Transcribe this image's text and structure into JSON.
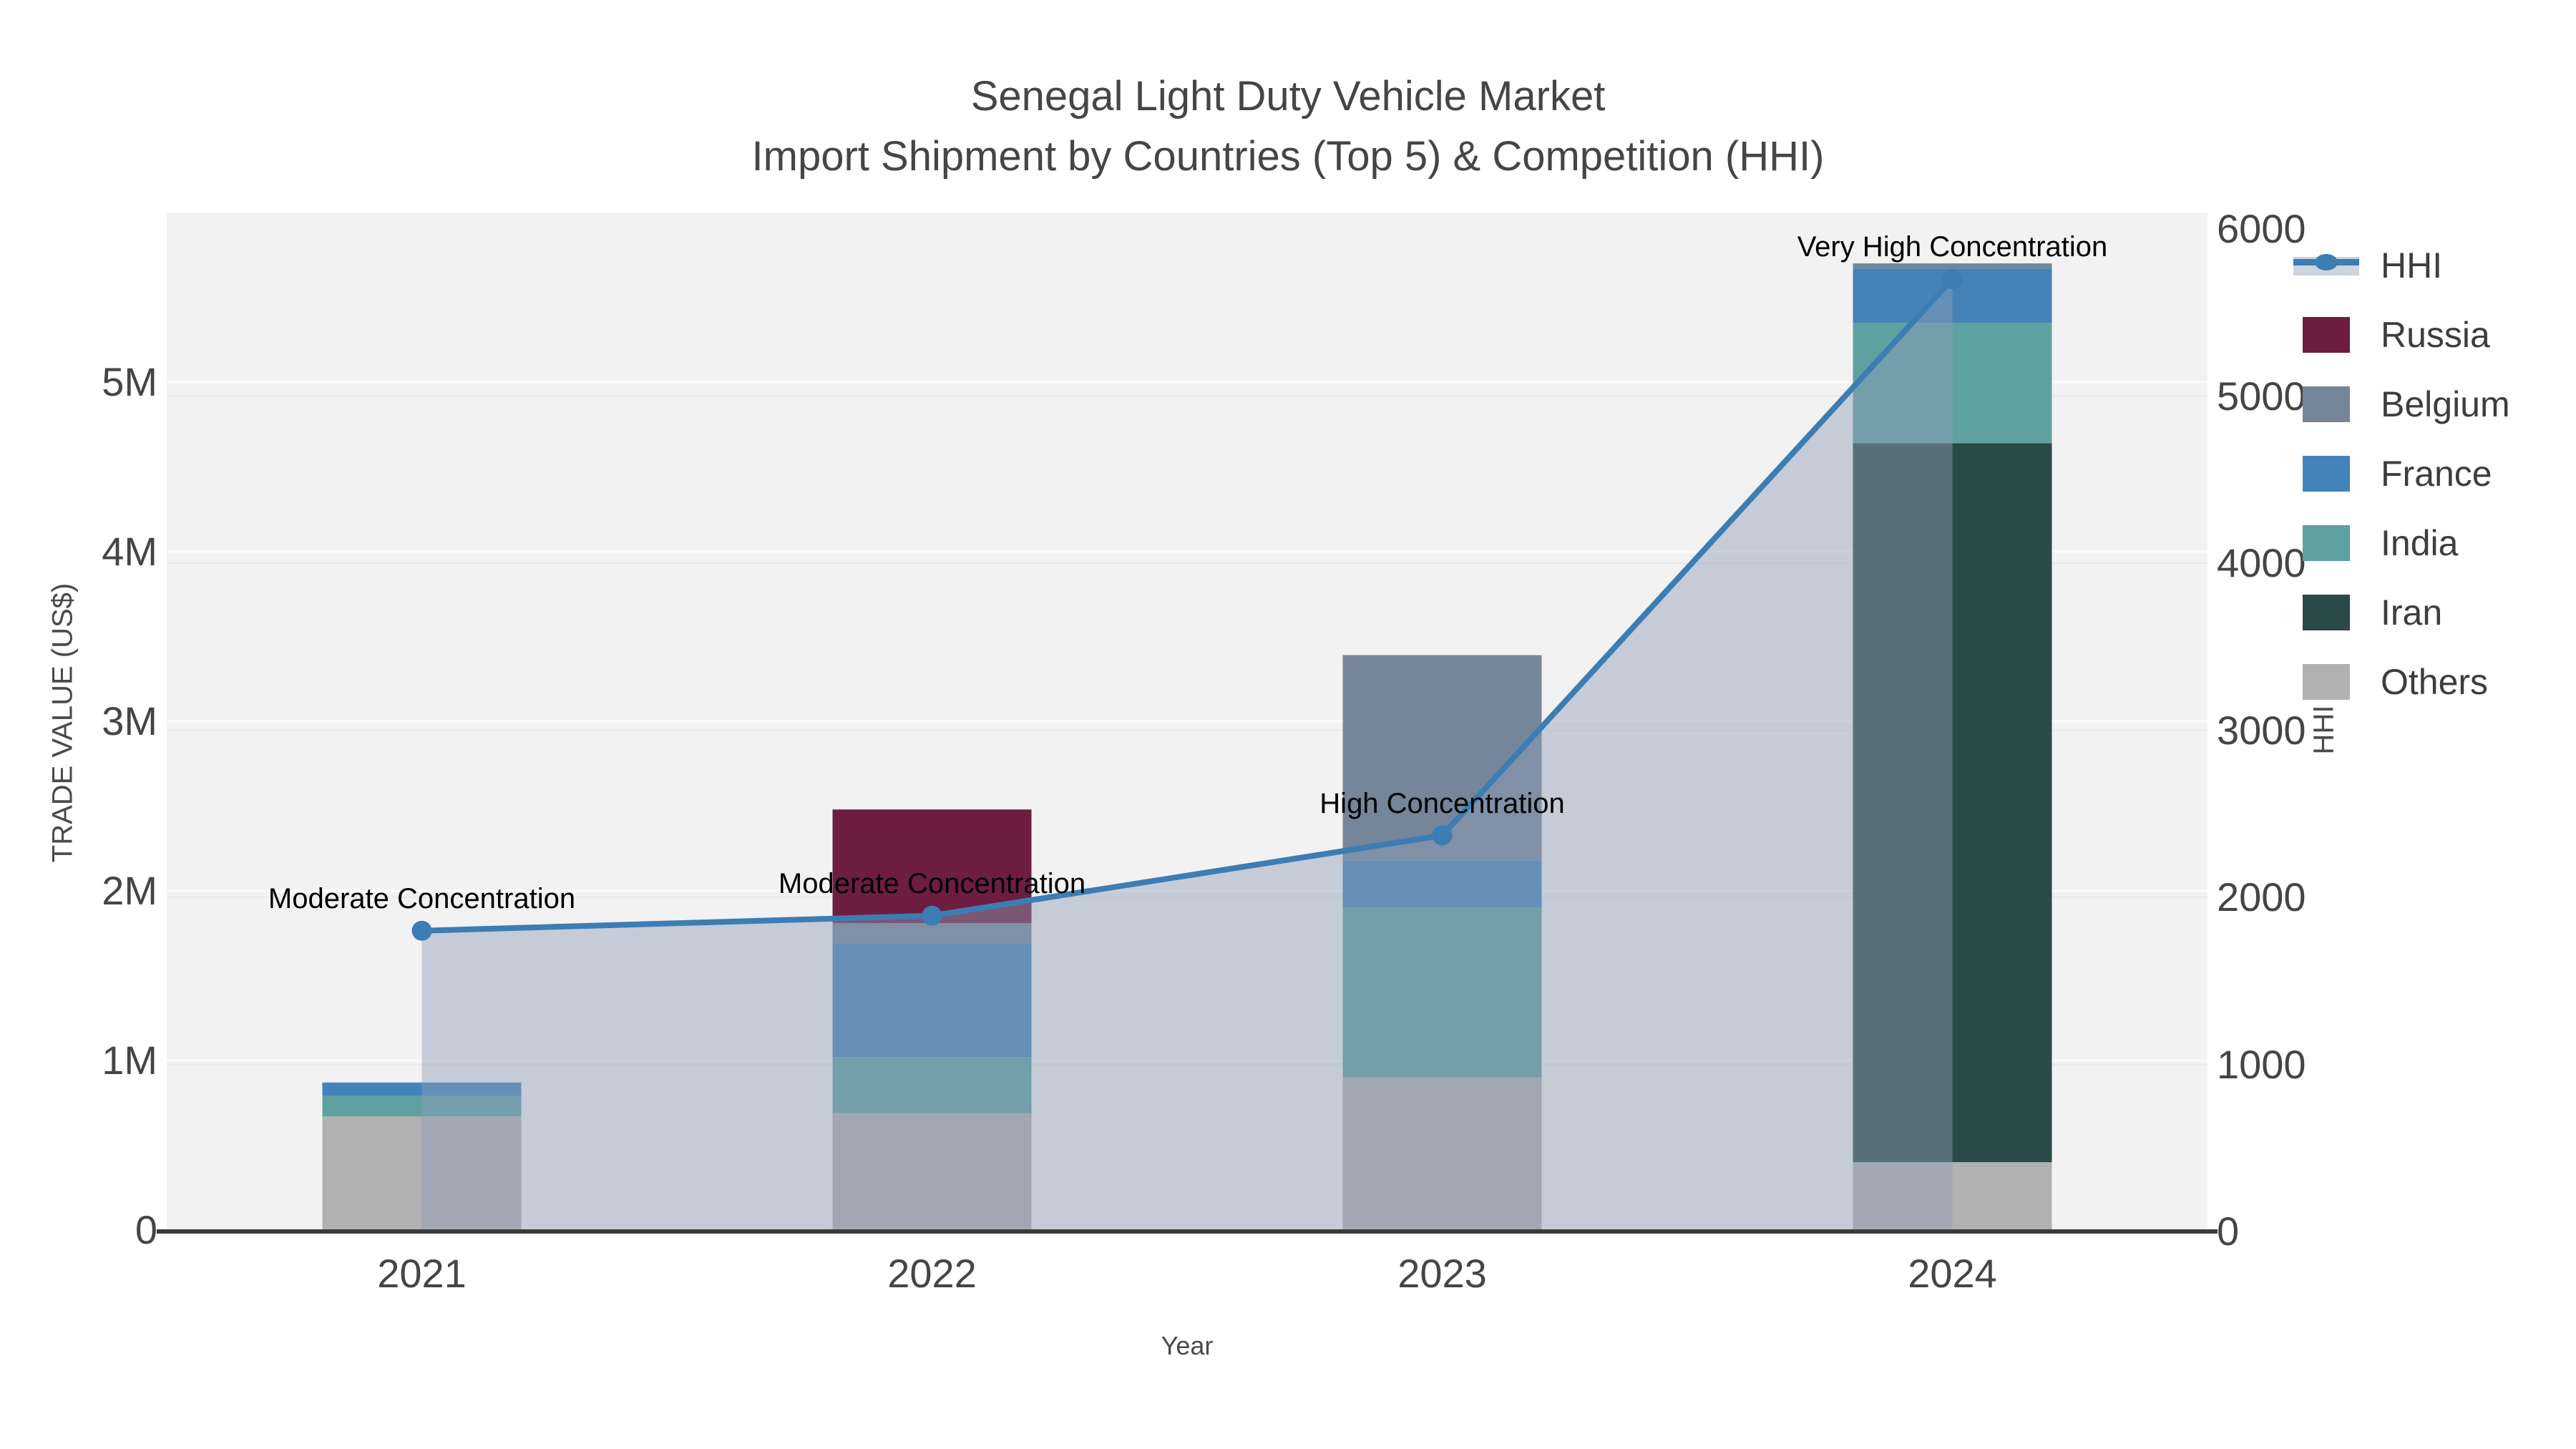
{
  "title": {
    "line1": "Senegal Light Duty Vehicle Market",
    "line2": "Import Shipment by Countries (Top 5) & Competition (HHI)"
  },
  "axes": {
    "left": {
      "title": "TRADE VALUE (US$)",
      "tick_labels": [
        "0",
        "1M",
        "2M",
        "3M",
        "4M",
        "5M"
      ]
    },
    "right": {
      "title": "HHI",
      "tick_labels": [
        "0",
        "1000",
        "2000",
        "3000",
        "4000",
        "5000",
        "6000"
      ]
    },
    "x": {
      "title": "Year",
      "tick_labels": [
        "2021",
        "2022",
        "2023",
        "2024"
      ]
    }
  },
  "legend": {
    "items": [
      {
        "label": "HHI",
        "type": "line-marker",
        "color": "#3c7db3",
        "band_color": "#ccd4df"
      },
      {
        "label": "Russia",
        "type": "square",
        "color": "#6d1d40"
      },
      {
        "label": "Belgium",
        "type": "square",
        "color": "#75869b"
      },
      {
        "label": "France",
        "type": "square",
        "color": "#4483b9"
      },
      {
        "label": "India",
        "type": "square",
        "color": "#5fa1a0"
      },
      {
        "label": "Iran",
        "type": "square",
        "color": "#2b4946"
      },
      {
        "label": "Others",
        "type": "square",
        "color": "#b1b1b1"
      }
    ]
  },
  "chart_data": {
    "type": "bar",
    "subtype": "stacked bars with overlaid line+area (dual axis)",
    "categories": [
      "2021",
      "2022",
      "2023",
      "2024"
    ],
    "bar_value_unit": "US$ millions (left axis)",
    "series": [
      {
        "name": "Others",
        "color": "#b1b1b1",
        "values": [
          0.67,
          0.69,
          0.9,
          0.4
        ]
      },
      {
        "name": "Iran",
        "color": "#2b4946",
        "values": [
          0,
          0,
          0,
          4.24
        ]
      },
      {
        "name": "India",
        "color": "#5fa1a0",
        "values": [
          0.12,
          0.33,
          1.0,
          0.71
        ]
      },
      {
        "name": "France",
        "color": "#4483b9",
        "values": [
          0.08,
          0.67,
          0.28,
          0.32
        ]
      },
      {
        "name": "Belgium",
        "color": "#75869b",
        "values": [
          0,
          0.12,
          1.21,
          0.03
        ]
      },
      {
        "name": "Russia",
        "color": "#6d1d40",
        "values": [
          0,
          0.67,
          0,
          0
        ]
      }
    ],
    "line_series": {
      "name": "HHI",
      "color": "#3c7db3",
      "area_color": "rgba(141,158,181,0.45)",
      "values": [
        1800,
        1890,
        2370,
        5700
      ]
    },
    "annotations": [
      "Moderate Concentration",
      "Moderate Concentration",
      "High Concentration",
      "Very High Concentration"
    ],
    "left_axis": {
      "range": [
        0,
        6
      ],
      "tick_values": [
        0,
        1,
        2,
        3,
        4,
        5
      ]
    },
    "right_axis": {
      "range": [
        0,
        6000
      ],
      "tick_values": [
        0,
        1000,
        2000,
        3000,
        4000,
        5000,
        6000
      ]
    },
    "grid": true,
    "legend_position": "right"
  },
  "colors": {
    "background": "#ffffff",
    "plot_background": "#f2f2f3",
    "grid_left": "#fbfbfb",
    "grid_right": "#e9e9ea",
    "axis_line": "#3a3a3a",
    "text": "#454545",
    "annotation_text": "#000000"
  }
}
